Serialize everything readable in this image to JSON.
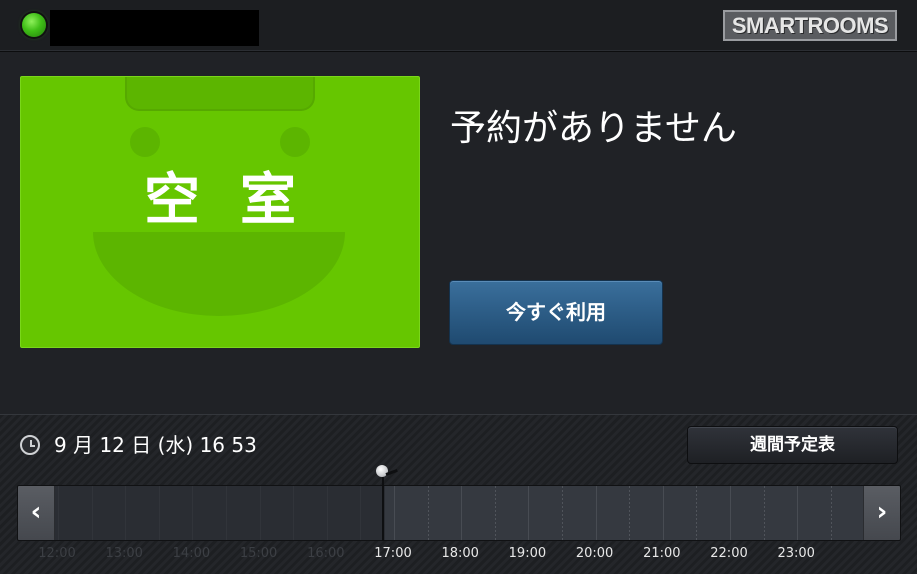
{
  "header": {
    "room_name": "",
    "logo_text": "SMARTROOMS",
    "status_color": "#44c21a"
  },
  "status_card": {
    "label": "空室",
    "color": "#66c600"
  },
  "main": {
    "message": "予約がありません",
    "use_now_label": "今すぐ利用"
  },
  "footer": {
    "datetime": "9 月 12 日 (水)  16 53",
    "weekly_schedule_label": "週間予定表"
  },
  "timeline": {
    "prev_icon": "chevron-left-icon",
    "next_icon": "chevron-right-icon",
    "prev_glyph": "‹",
    "next_glyph": "›",
    "hours": [
      {
        "label": "12:00",
        "past": true
      },
      {
        "label": "13:00",
        "past": true
      },
      {
        "label": "14:00",
        "past": true
      },
      {
        "label": "15:00",
        "past": true
      },
      {
        "label": "16:00",
        "past": true
      },
      {
        "label": "17:00",
        "past": false
      },
      {
        "label": "18:00",
        "past": false
      },
      {
        "label": "19:00",
        "past": false
      },
      {
        "label": "20:00",
        "past": false
      },
      {
        "label": "21:00",
        "past": false
      },
      {
        "label": "22:00",
        "past": false
      },
      {
        "label": "23:00",
        "past": false
      }
    ],
    "current_time": "16:53"
  }
}
